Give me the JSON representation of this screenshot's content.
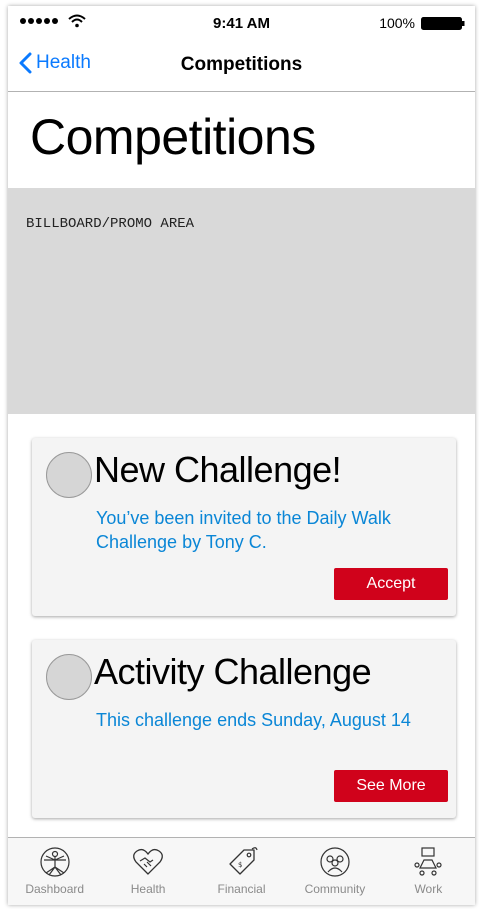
{
  "status_bar": {
    "time": "9:41 AM",
    "battery_percent": "100%"
  },
  "nav": {
    "back_label": "Health",
    "title": "Competitions"
  },
  "page": {
    "title": "Competitions",
    "billboard_label": "BILLBOARD/PROMO AREA"
  },
  "cards": [
    {
      "title": "New Challenge!",
      "description": "You’ve been invited to the Daily Walk Challenge by Tony C.",
      "button_label": "Accept"
    },
    {
      "title": "Activity Challenge",
      "description": "This challenge ends Sunday, August 14",
      "button_label": "See More"
    }
  ],
  "tab_bar": {
    "items": [
      {
        "label": "Dashboard",
        "icon": "vitruvian-man-icon"
      },
      {
        "label": "Health",
        "icon": "heart-handshake-icon"
      },
      {
        "label": "Financial",
        "icon": "price-tag-icon"
      },
      {
        "label": "Community",
        "icon": "people-circle-icon"
      },
      {
        "label": "Work",
        "icon": "meeting-table-icon"
      }
    ]
  },
  "colors": {
    "accent_blue": "#0a7aff",
    "link_blue": "#0a86d6",
    "button_red": "#d0021b",
    "billboard_gray": "#d9d9d9"
  }
}
